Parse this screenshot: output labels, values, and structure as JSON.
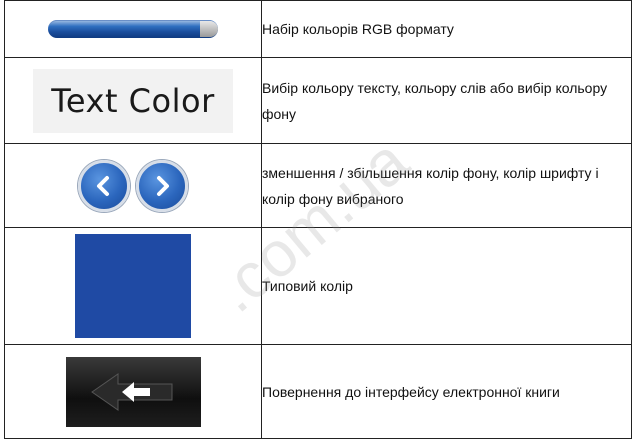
{
  "rows": [
    {
      "icon": "rgb-slider-bar-icon",
      "text": "Набір кольорів RGB формату"
    },
    {
      "icon": "text-color-button",
      "icon_text": "Text Color",
      "text": "Вибір кольору тексту, кольору слів або вибір кольору фону"
    },
    {
      "icon": "arrow-left-right-icons",
      "text": "зменшення / збільшення колір фону, колір шрифту і колір фону вибраного"
    },
    {
      "icon": "color-swatch",
      "swatch_color": "#1f4aa4",
      "text": "Типовий колір"
    },
    {
      "icon": "back-arrow-icon",
      "text": "Повернення до інтерфейсу електронної книги"
    }
  ],
  "watermark": ".com.ua"
}
